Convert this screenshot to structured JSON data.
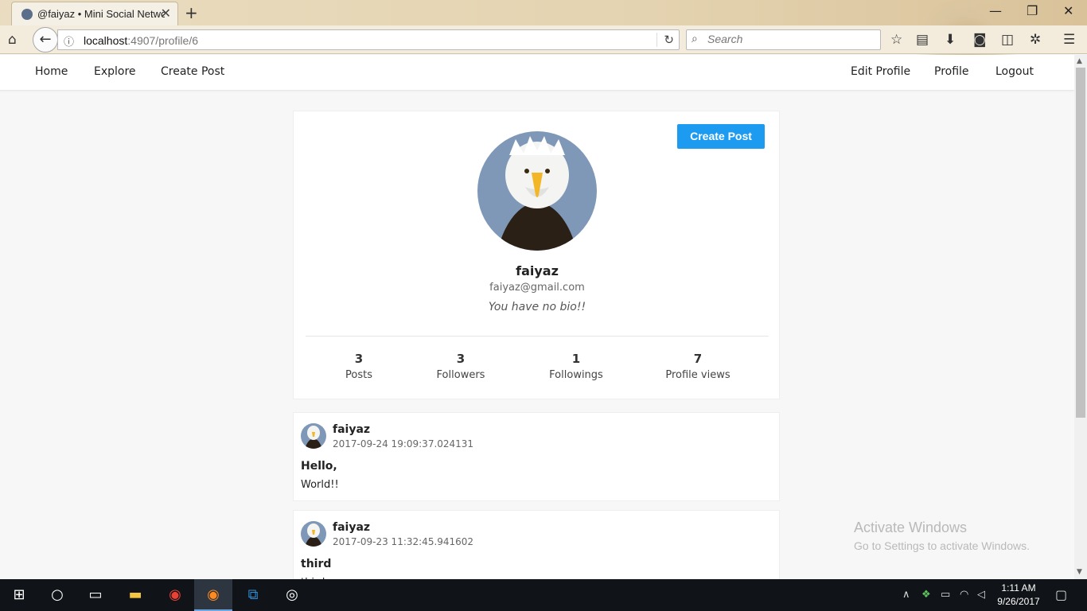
{
  "browser": {
    "tab_title": "@faiyaz • Mini Social Network",
    "tab_close": "✕",
    "new_tab": "+",
    "url_host": "localhost",
    "url_path": ":4907/profile/6",
    "search_placeholder": "Search"
  },
  "nav": {
    "left": [
      "Home",
      "Explore",
      "Create Post"
    ],
    "right": [
      "Edit Profile",
      "Profile",
      "Logout"
    ]
  },
  "profile": {
    "create_post_label": "Create Post",
    "username": "faiyaz",
    "email": "faiyaz@gmail.com",
    "bio": "You have no bio!!",
    "stats": [
      {
        "value": "3",
        "label": "Posts"
      },
      {
        "value": "3",
        "label": "Followers"
      },
      {
        "value": "1",
        "label": "Followings"
      },
      {
        "value": "7",
        "label": "Profile views"
      }
    ]
  },
  "posts": [
    {
      "author": "faiyaz",
      "date": "2017-09-24 19:09:37.024131",
      "title": "Hello,",
      "body": "World!!"
    },
    {
      "author": "faiyaz",
      "date": "2017-09-23 11:32:45.941602",
      "title": "third",
      "body": "third"
    }
  ],
  "watermark": {
    "line1": "Activate Windows",
    "line2": "Go to Settings to activate Windows."
  },
  "taskbar": {
    "time": "1:11 AM",
    "date": "9/26/2017"
  },
  "icons": {
    "home": "home-icon",
    "back": "back-arrow-icon",
    "info": "info-icon",
    "reload": "reload-icon",
    "search": "search-icon",
    "bookmark": "star-icon",
    "menu": "hamburger-menu-icon"
  },
  "colors": {
    "accent": "#1d9bf0"
  }
}
